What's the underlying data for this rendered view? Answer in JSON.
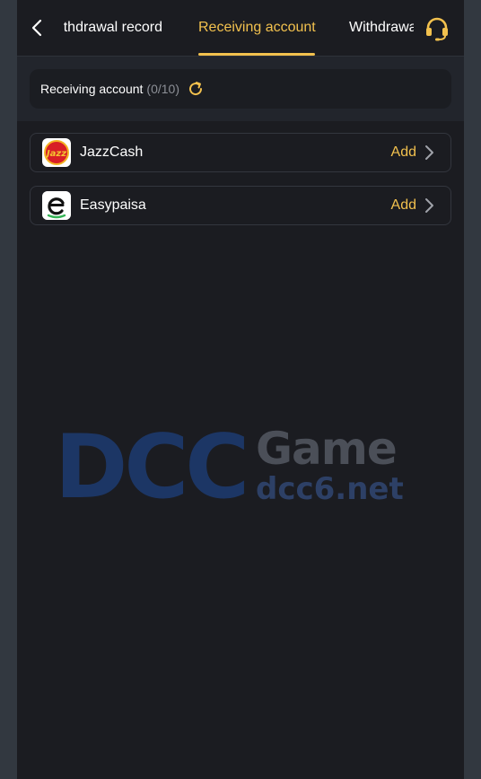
{
  "header": {
    "tabs": [
      {
        "label": "Withdrawal record"
      },
      {
        "label": "Receiving account"
      },
      {
        "label": "Withdrawal limit"
      }
    ],
    "active_tab": 1,
    "icons": {
      "back": "chevron-left-icon",
      "support": "headset-icon"
    }
  },
  "summary": {
    "title": "Receiving account",
    "count": "(0/10)",
    "icon": "refresh-icon"
  },
  "accounts": [
    {
      "name": "JazzCash",
      "action": "Add",
      "logo_text": "Jazz",
      "icon": "jazzcash-logo-icon"
    },
    {
      "name": "Easypaisa",
      "action": "Add",
      "logo_text": "e",
      "icon": "easypaisa-logo-icon"
    }
  ],
  "watermark": {
    "brand": "DCC",
    "word": "Game",
    "site": "dcc6.net"
  },
  "colors": {
    "accent": "#f2c14e",
    "background": "#1b1c21",
    "side_margin": "#323840"
  }
}
